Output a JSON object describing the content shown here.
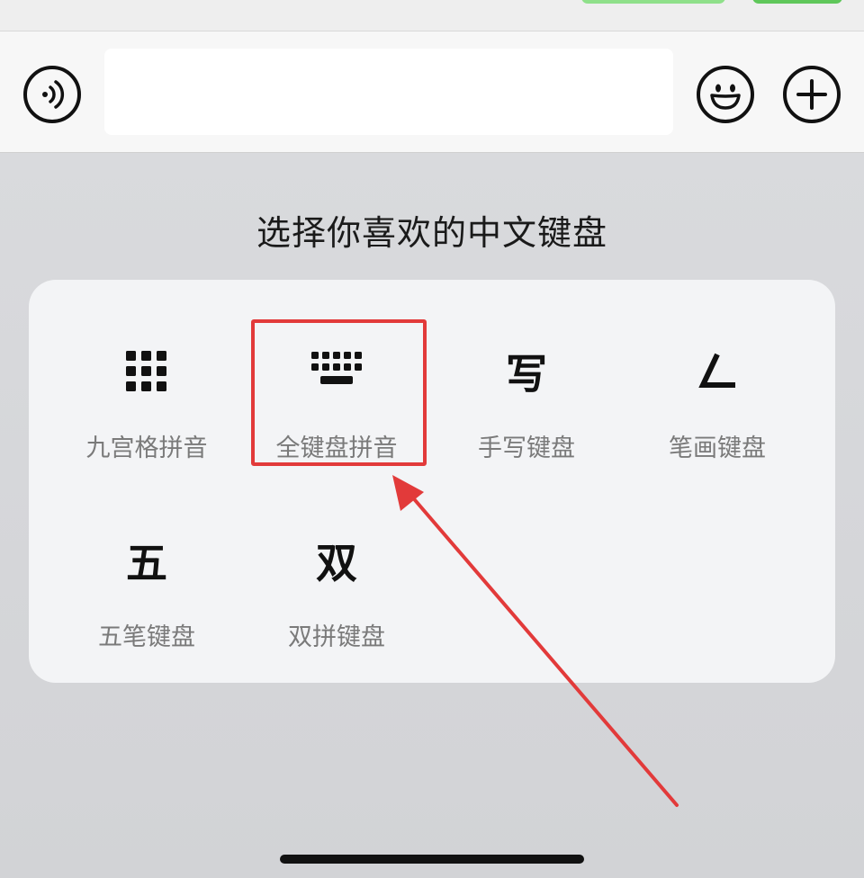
{
  "input_bar": {
    "voice_icon": "voice-input-icon",
    "emoji_icon": "emoji-icon",
    "plus_icon": "plus-icon",
    "text_value": ""
  },
  "keyboard_picker": {
    "title": "选择你喜欢的中文键盘",
    "options": [
      {
        "label": "九宫格拼音",
        "icon": "nine-grid-icon"
      },
      {
        "label": "全键盘拼音",
        "icon": "full-keyboard-icon",
        "highlighted": true
      },
      {
        "label": "手写键盘",
        "icon_glyph": "写"
      },
      {
        "label": "笔画键盘",
        "icon_glyph": "㇕"
      },
      {
        "label": "五笔键盘",
        "icon_glyph": "五"
      },
      {
        "label": "双拼键盘",
        "icon_glyph": "双"
      }
    ]
  },
  "colors": {
    "highlight": "#e23a3a",
    "panel_bg": "#f3f4f6",
    "label_gray": "#7a7a7a"
  }
}
